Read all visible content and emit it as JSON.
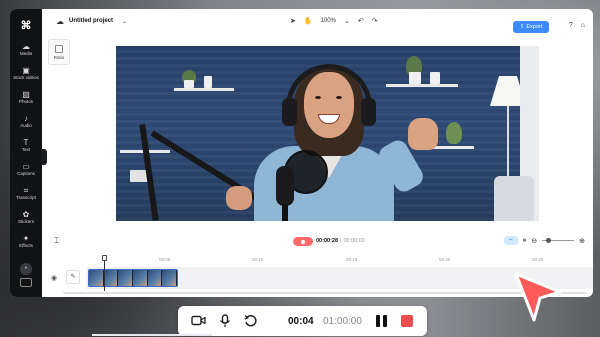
{
  "app": {
    "project_name": "Untitled project",
    "zoom_level": "100%",
    "export_label": "Export",
    "ratio_label": "Ratio"
  },
  "sidebar": {
    "items": [
      {
        "label": "Media",
        "icon": "media-icon"
      },
      {
        "label": "Stock videos",
        "icon": "stock-videos-icon"
      },
      {
        "label": "Photos",
        "icon": "photos-icon"
      },
      {
        "label": "Audio",
        "icon": "audio-icon"
      },
      {
        "label": "Text",
        "icon": "text-icon"
      },
      {
        "label": "Captions",
        "icon": "captions-icon"
      },
      {
        "label": "Transcript",
        "icon": "transcript-icon"
      },
      {
        "label": "Stickers",
        "icon": "stickers-icon"
      },
      {
        "label": "Effects",
        "icon": "effects-icon"
      }
    ]
  },
  "timeline": {
    "current_time": "00:00:28",
    "total_time": "00:00:00",
    "ruler": [
      "00:05",
      "00:10",
      "00:15",
      "00:20",
      "00:25"
    ]
  },
  "recorder": {
    "elapsed": "00:04",
    "limit": "01:00:00"
  },
  "colors": {
    "accent": "#3d8bfd",
    "record_red": "#e84c4c",
    "pointer": "#ff5a5a"
  }
}
